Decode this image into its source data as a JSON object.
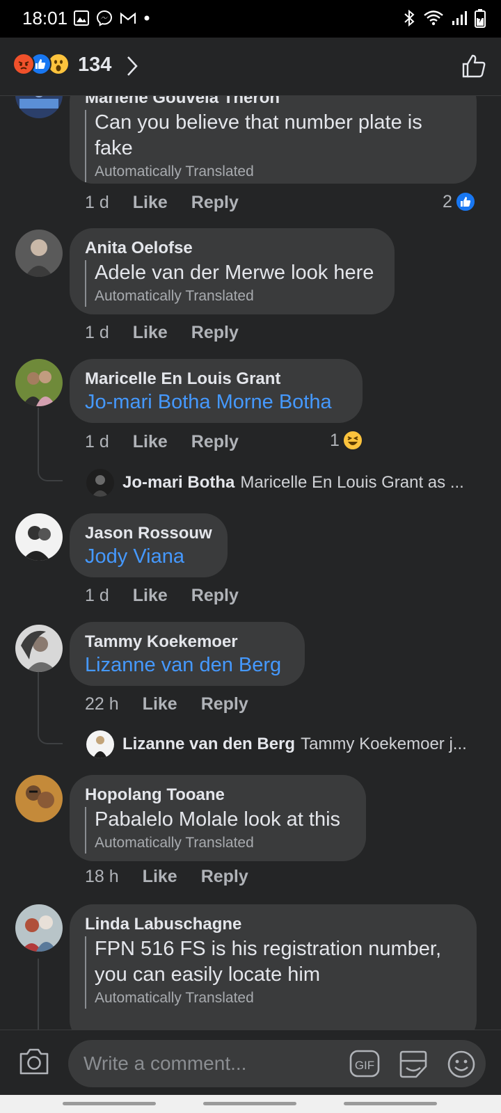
{
  "status_bar": {
    "time": "18:01",
    "left_icons": [
      "gallery-icon",
      "messenger-icon",
      "gmail-icon",
      "dot-icon"
    ],
    "right_icons": [
      "bluetooth-icon",
      "wifi-icon",
      "signal-icon",
      "battery-charging-icon"
    ]
  },
  "reactions": {
    "icons": [
      "angry-icon",
      "like-icon",
      "wow-icon"
    ],
    "count": "134"
  },
  "comments": [
    {
      "author": "Marlene Gouveia Theron",
      "text": "Can you believe that number plate is fake",
      "translated": "Automatically Translated",
      "time": "1 d",
      "like": "Like",
      "reply": "Reply",
      "reaction_count": "2",
      "reaction_icon": "like-icon"
    },
    {
      "author": "Anita Oelofse",
      "text": "Adele van der Merwe look here",
      "translated": "Automatically Translated",
      "time": "1 d",
      "like": "Like",
      "reply": "Reply"
    },
    {
      "author": "Maricelle En Louis Grant",
      "text": "Jo-mari Botha Morne Botha",
      "time": "1 d",
      "like": "Like",
      "reply": "Reply",
      "reaction_count": "1",
      "reaction_icon": "haha-icon",
      "reply_preview": {
        "author": "Jo-mari Botha",
        "text": "Maricelle En Louis Grant as ..."
      }
    },
    {
      "author": "Jason Rossouw",
      "text": "Jody Viana",
      "time": "1 d",
      "like": "Like",
      "reply": "Reply"
    },
    {
      "author": "Tammy Koekemoer",
      "text": "Lizanne van den Berg",
      "time": "22 h",
      "like": "Like",
      "reply": "Reply",
      "reply_preview": {
        "author": "Lizanne van den Berg",
        "text": "Tammy Koekemoer j..."
      }
    },
    {
      "author": "Hopolang Tooane",
      "text": "Pabalelo Molale look at this",
      "translated": "Automatically Translated",
      "time": "18 h",
      "like": "Like",
      "reply": "Reply"
    },
    {
      "author": "Linda Labuschagne",
      "text": "FPN 516 FS is his registration number, you can easily locate him",
      "translated": "Automatically Translated"
    }
  ],
  "composer": {
    "placeholder": "Write a comment...",
    "gif_label": "GIF"
  },
  "colors": {
    "background": "#242526",
    "bubble": "#3a3b3c",
    "mention": "#4599ff",
    "like_blue": "#1877f2",
    "angry": "#f0512b",
    "wow_yellow": "#fcc33d"
  }
}
